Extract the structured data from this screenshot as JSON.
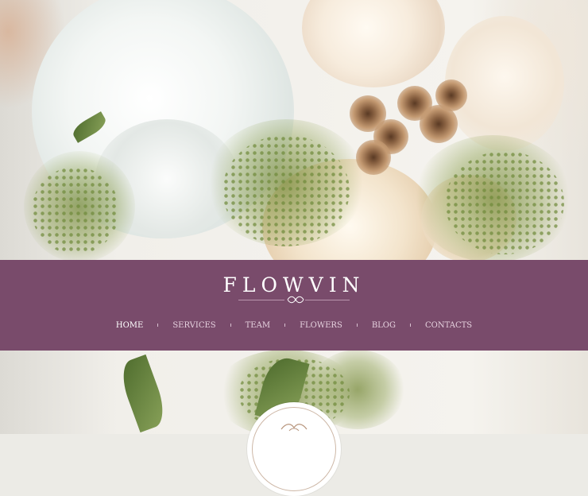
{
  "site": {
    "logo_text": "FLOWVIN"
  },
  "nav": {
    "items": [
      {
        "label": "HOME",
        "active": true
      },
      {
        "label": "SERVICES",
        "active": false
      },
      {
        "label": "TEAM",
        "active": false
      },
      {
        "label": "FLOWERS",
        "active": false
      },
      {
        "label": "BLOG",
        "active": false
      },
      {
        "label": "CONTACTS",
        "active": false
      }
    ]
  },
  "colors": {
    "band": "#794b6b",
    "nav_active": "#ffffff",
    "nav_inactive": "#e6d2df"
  },
  "hero": {
    "image": "bouquet-photo"
  },
  "emblem": {
    "icon": "ornament-icon"
  }
}
